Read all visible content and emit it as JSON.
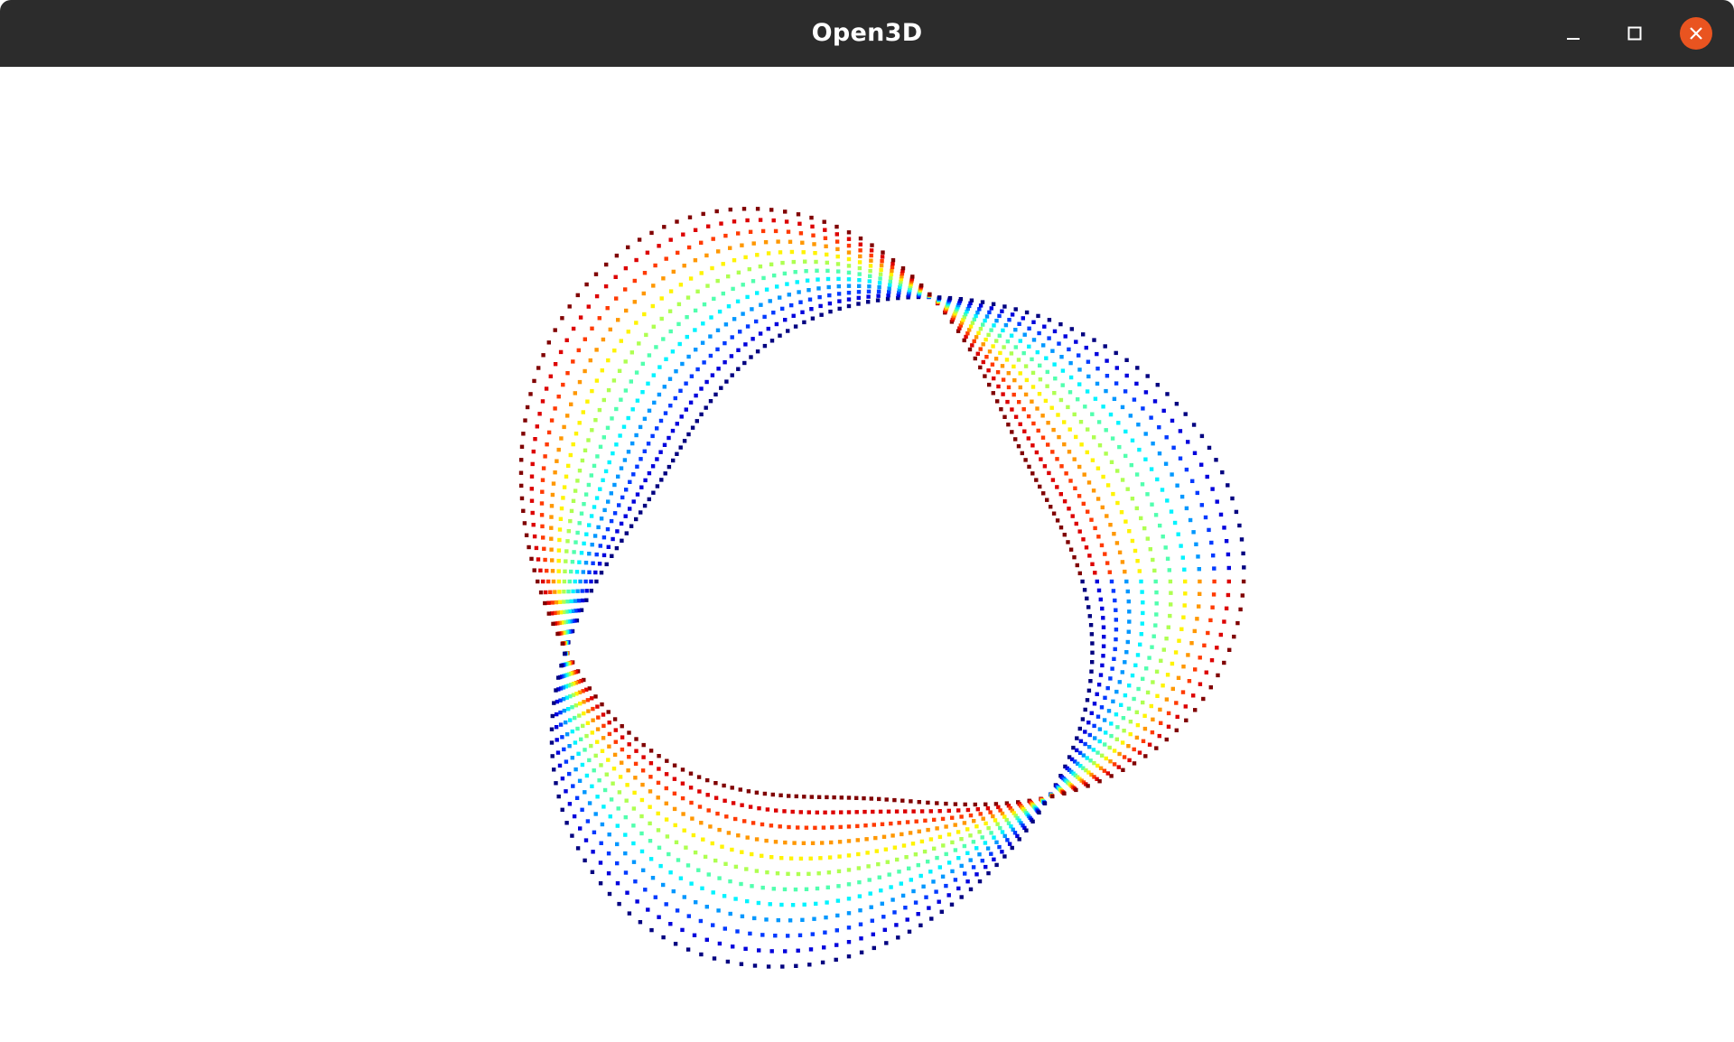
{
  "window": {
    "title": "Open3D",
    "controls": [
      {
        "name": "minimize",
        "icon": "minimize-icon"
      },
      {
        "name": "maximize",
        "icon": "maximize-icon"
      },
      {
        "name": "close",
        "icon": "close-icon"
      }
    ]
  },
  "colors": {
    "titlebar_bg": "#2c2c2c",
    "title_text": "#ffffff",
    "close_button": "#e95420",
    "control_icon": "#ffffff",
    "viewport_bg": "#ffffff"
  },
  "scene": {
    "type": "point-cloud",
    "description_icon": "point-cloud",
    "colormap": "jet"
  }
}
